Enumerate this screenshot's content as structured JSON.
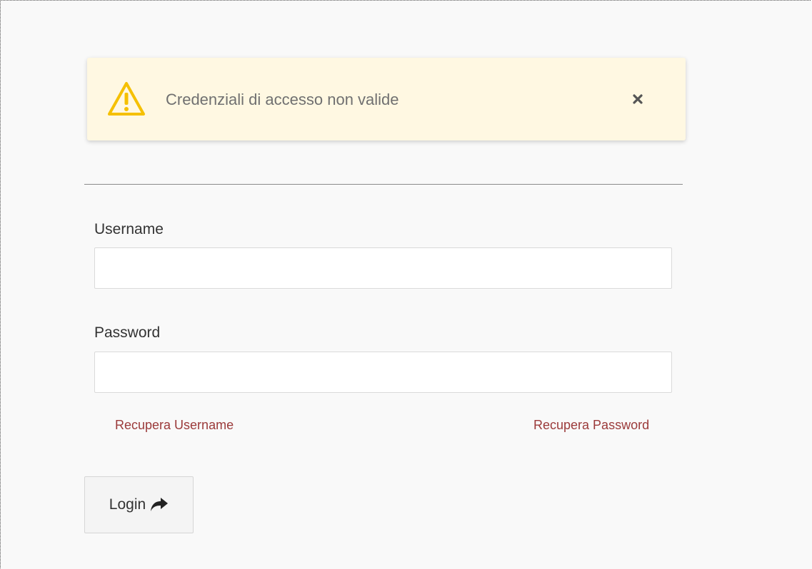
{
  "alert": {
    "message": "Credenziali di accesso non valide",
    "icon": "warning-triangle-icon",
    "close_icon": "close-icon",
    "color_background": "#fff8e2",
    "color_icon": "#f5c000"
  },
  "form": {
    "username": {
      "label": "Username",
      "value": "",
      "placeholder": ""
    },
    "password": {
      "label": "Password",
      "value": "",
      "placeholder": ""
    },
    "links": {
      "recover_username": "Recupera Username",
      "recover_password": "Recupera Password",
      "color": "#9b3a3a"
    },
    "login_button": {
      "label": "Login",
      "icon": "share-arrow-icon"
    }
  }
}
